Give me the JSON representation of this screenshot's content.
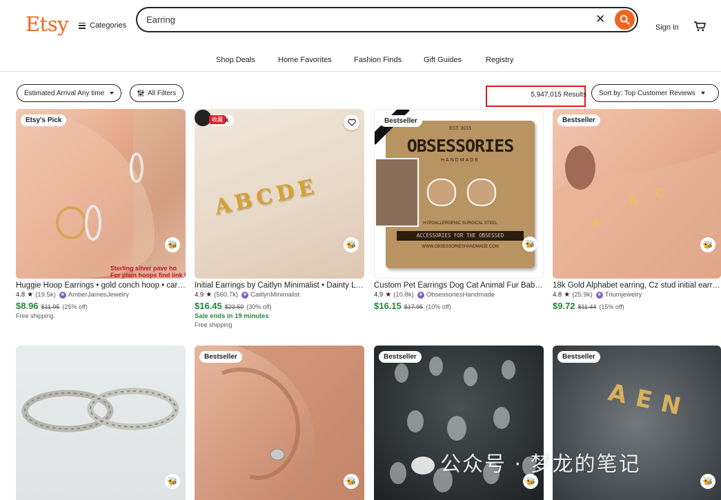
{
  "header": {
    "logo": "Etsy",
    "categories_label": "Categories",
    "search_value": "Earring",
    "signin_label": "Sign in"
  },
  "nav": [
    "Shop Deals",
    "Home Favorites",
    "Fashion Finds",
    "Gift Guides",
    "Registry"
  ],
  "filters": {
    "arrival_label": "Estimated Arrival Any time",
    "all_filters_label": "All Filters",
    "results": "5,947,015 Results",
    "sort_label": "Sort by: Top Customer Reviews"
  },
  "products": [
    {
      "badge": "Etsy's Pick",
      "title": "Huggie Hoop Earrings • gold conch hoop • cartilage hoop",
      "rating": "4.8",
      "reviews": "(19.5k)",
      "shop": "AmberJamesJewelry",
      "price": "$8.96",
      "orig": "$11.95",
      "off": "(25% off)",
      "sale": "",
      "ship": "Free shipping",
      "image_text": "Sterling silver pave ho\nFor plain hoops find link l"
    },
    {
      "badge": "Pick",
      "title": "Initial Earrings by Caitlyn Minimalist • Dainty Letter Studs",
      "rating": "4.9",
      "reviews": "(560.7k)",
      "shop": "CaitlynMinimalist",
      "price": "$16.45",
      "orig": "$23.50",
      "off": "(30% off)",
      "sale": "Sale ends in 19 minutes",
      "ship": "Free shipping",
      "overlay_tag": "收藏",
      "image_text": "ABCDE"
    },
    {
      "badge": "Bestseller",
      "title": "Custom Pet Earrings Dog Cat Animal Fur Baby Studs",
      "rating": "4.9",
      "reviews": "(10.8k)",
      "shop": "ObsessoriesHandmade",
      "price": "$16.15",
      "orig": "$17.95",
      "off": "(10% off)",
      "sale": "",
      "ship": "",
      "card": {
        "est": "EST. 2015",
        "brand": "OBSESSORIES",
        "sub": "HANDMADE",
        "line1": "HYPOALLERGENIC SURGICAL STEEL",
        "line2": "ACCESSORIES FOR THE OBSESSED",
        "line3": "WWW.OBSESSORIESHANDMADE.COM"
      }
    },
    {
      "badge": "Bestseller",
      "title": "18k Gold Alphabet earring, Cz stud initial earring",
      "rating": "4.8",
      "reviews": "(25.9k)",
      "shop": "Triumjewelry",
      "price": "$9.72",
      "orig": "$11.44",
      "off": "(15% off)",
      "sale": "",
      "ship": ""
    },
    {
      "badge": "",
      "title": "",
      "rating": "",
      "reviews": "",
      "shop": "",
      "price": "",
      "orig": "",
      "off": "",
      "sale": "",
      "ship": ""
    },
    {
      "badge": "Bestseller",
      "title": "",
      "rating": "",
      "reviews": "",
      "shop": "",
      "price": "",
      "orig": "",
      "off": "",
      "sale": "",
      "ship": ""
    },
    {
      "badge": "Bestseller",
      "title": "",
      "rating": "",
      "reviews": "",
      "shop": "",
      "price": "",
      "orig": "",
      "off": "",
      "sale": "",
      "ship": ""
    },
    {
      "badge": "Bestseller",
      "title": "",
      "rating": "",
      "reviews": "",
      "shop": "",
      "price": "",
      "orig": "",
      "off": "",
      "sale": "",
      "ship": "",
      "image_text": "AEN"
    }
  ],
  "watermark": "公众号 · 梦龙的笔记",
  "colors": {
    "brand": "#f1641e",
    "sale_green": "#258635",
    "highlight_red": "#e01b1b"
  }
}
